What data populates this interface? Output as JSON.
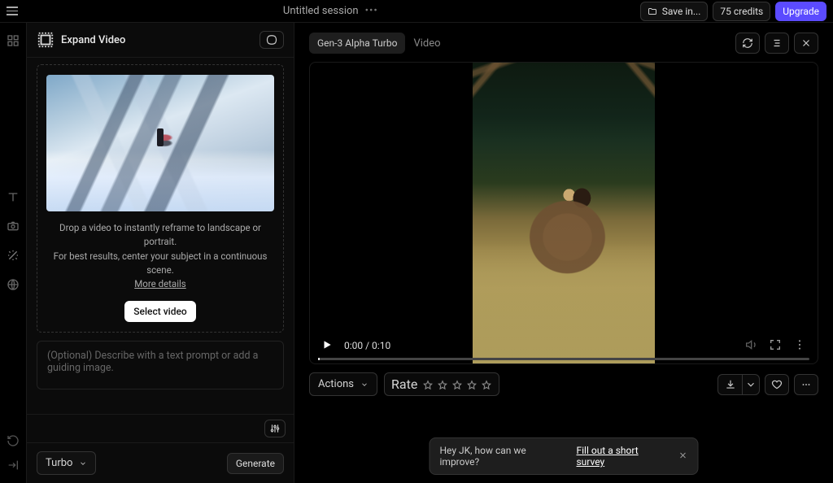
{
  "topbar": {
    "title": "Untitled session",
    "save_label": "Save in...",
    "credits_label": "75 credits",
    "upgrade_label": "Upgrade"
  },
  "left": {
    "panel_title": "Expand Video",
    "drop_line1": "Drop a video to instantly reframe to landscape or portrait.",
    "drop_line2": "For best results, center your subject in a continuous scene.",
    "more_details": "More details",
    "select_video": "Select video",
    "prompt_placeholder": "(Optional) Describe with a text prompt or add a guiding image.",
    "model_select": "Turbo",
    "generate_label": "Generate"
  },
  "main": {
    "model_tag": "Gen-3 Alpha Turbo",
    "type_tag": "Video",
    "time_current": "0:00",
    "time_total": "0:10",
    "actions_label": "Actions",
    "rate_label": "Rate"
  },
  "toast": {
    "msg": "Hey JK, how can we improve?",
    "link": "Fill out a short survey"
  }
}
